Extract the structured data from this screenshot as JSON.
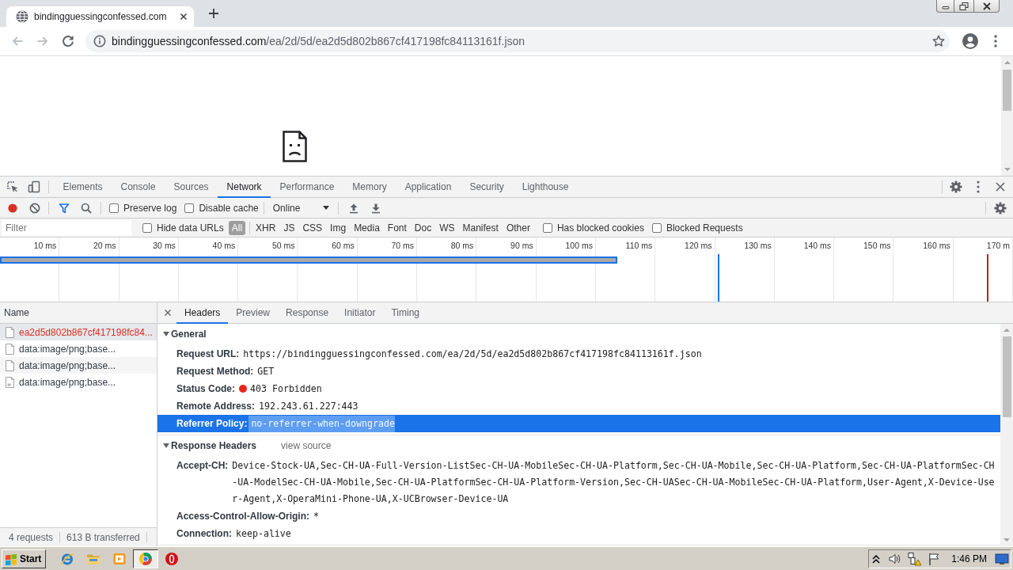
{
  "browser_tabs": [
    {
      "title": "bindingguessingconfessed.com",
      "selected": true
    }
  ],
  "navigation": {
    "back_disabled": true,
    "forward_disabled": true
  },
  "address_bar": {
    "url_host": "bindingguessingconfessed.com",
    "url_path": "/ea/2d/5d/ea2d5d802b867cf417198fc84113161f.json"
  },
  "devtools": {
    "tabs": [
      {
        "label": "Elements",
        "selected": false
      },
      {
        "label": "Console",
        "selected": false
      },
      {
        "label": "Sources",
        "selected": false
      },
      {
        "label": "Network",
        "selected": true
      },
      {
        "label": "Performance",
        "selected": false
      },
      {
        "label": "Memory",
        "selected": false
      },
      {
        "label": "Application",
        "selected": false
      },
      {
        "label": "Security",
        "selected": false
      },
      {
        "label": "Lighthouse",
        "selected": false
      }
    ],
    "toolbar": {
      "recording": true,
      "filter_on": true,
      "checkboxes": [
        {
          "label": "Preserve log",
          "checked": false
        },
        {
          "label": "Disable cache",
          "checked": false
        }
      ],
      "throttling": "Online"
    },
    "filter_bar": {
      "placeholder": "Filter",
      "hide_data_urls": {
        "label": "Hide data URLs",
        "checked": false
      },
      "types": [
        {
          "label": "All",
          "selected": true
        },
        {
          "label": "XHR",
          "selected": false
        },
        {
          "label": "JS",
          "selected": false
        },
        {
          "label": "CSS",
          "selected": false
        },
        {
          "label": "Img",
          "selected": false
        },
        {
          "label": "Media",
          "selected": false
        },
        {
          "label": "Font",
          "selected": false
        },
        {
          "label": "Doc",
          "selected": false
        },
        {
          "label": "WS",
          "selected": false
        },
        {
          "label": "Manifest",
          "selected": false
        },
        {
          "label": "Other",
          "selected": false
        }
      ],
      "checkboxes": [
        {
          "label": "Has blocked cookies",
          "checked": false
        },
        {
          "label": "Blocked Requests",
          "checked": false
        }
      ]
    },
    "overview": {
      "ticks": [
        "10 ms",
        "20 ms",
        "30 ms",
        "40 ms",
        "50 ms",
        "60 ms",
        "70 ms",
        "80 ms",
        "90 ms",
        "100 ms",
        "110 ms",
        "120 ms",
        "130 ms",
        "140 ms",
        "150 ms",
        "160 ms",
        "170 m"
      ]
    },
    "requests": {
      "column": "Name",
      "rows": [
        {
          "name": "ea2d5d802b867cf417198fc84...",
          "kind": "document",
          "error": true,
          "selected": true
        },
        {
          "name": "data:image/png;base...",
          "kind": "document",
          "error": false,
          "selected": false
        },
        {
          "name": "data:image/png;base...",
          "kind": "document",
          "error": false,
          "selected": false
        },
        {
          "name": "data:image/png;base...",
          "kind": "image",
          "error": false,
          "selected": false
        }
      ],
      "summary": [
        "4 requests",
        "613 B transferred"
      ]
    },
    "details": {
      "tabs": [
        {
          "label": "Headers",
          "selected": true
        },
        {
          "label": "Preview",
          "selected": false
        },
        {
          "label": "Response",
          "selected": false
        },
        {
          "label": "Initiator",
          "selected": false
        },
        {
          "label": "Timing",
          "selected": false
        }
      ],
      "sections": [
        {
          "title": "General",
          "expanded": true,
          "rows": [
            {
              "label": "Request URL:",
              "value": "https://bindingguessingconfessed.com/ea/2d/5d/ea2d5d802b867cf417198fc84113161f.json",
              "selected": false
            },
            {
              "label": "Request Method:",
              "value": "GET",
              "selected": false
            },
            {
              "label": "Status Code:",
              "value": "403 Forbidden",
              "color": "#e8261c",
              "selected": false
            },
            {
              "label": "Remote Address:",
              "value": "192.243.61.227:443",
              "selected": false
            },
            {
              "label": "Referrer Policy:",
              "value": "no-referrer-when-downgrade",
              "selected": true
            }
          ]
        },
        {
          "title": "Response Headers",
          "expanded": true,
          "link": "view source",
          "rows": [
            {
              "label": "Accept-CH:",
              "value": "Device-Stock-UA,Sec-CH-UA-Full-Version-ListSec-CH-UA-MobileSec-CH-UA-Platform,Sec-CH-UA-Mobile,Sec-CH-UA-Platform,Sec-CH-UA-PlatformSec-CH-UA-ModelSec-CH-UA-Mobile,Sec-CH-UA-PlatformSec-CH-UA-Platform-Version,Sec-CH-UASec-CH-UA-MobileSec-CH-UA-Platform,User-Agent,X-Device-User-Agent,X-OperaMini-Phone-UA,X-UCBrowser-Device-UA",
              "selected": false
            },
            {
              "label": "Access-Control-Allow-Origin:",
              "value": "*",
              "selected": false
            },
            {
              "label": "Connection:",
              "value": "keep-alive",
              "selected": false
            }
          ]
        }
      ]
    }
  },
  "taskbar": {
    "start": "Start",
    "apps": [
      {
        "kind": "swoosh",
        "selected": false
      },
      {
        "kind": "folder",
        "selected": false
      },
      {
        "kind": "player",
        "selected": false
      },
      {
        "kind": "wheel",
        "selected": true
      },
      {
        "kind": "disc",
        "selected": false
      }
    ],
    "clock": "1:46 PM"
  }
}
